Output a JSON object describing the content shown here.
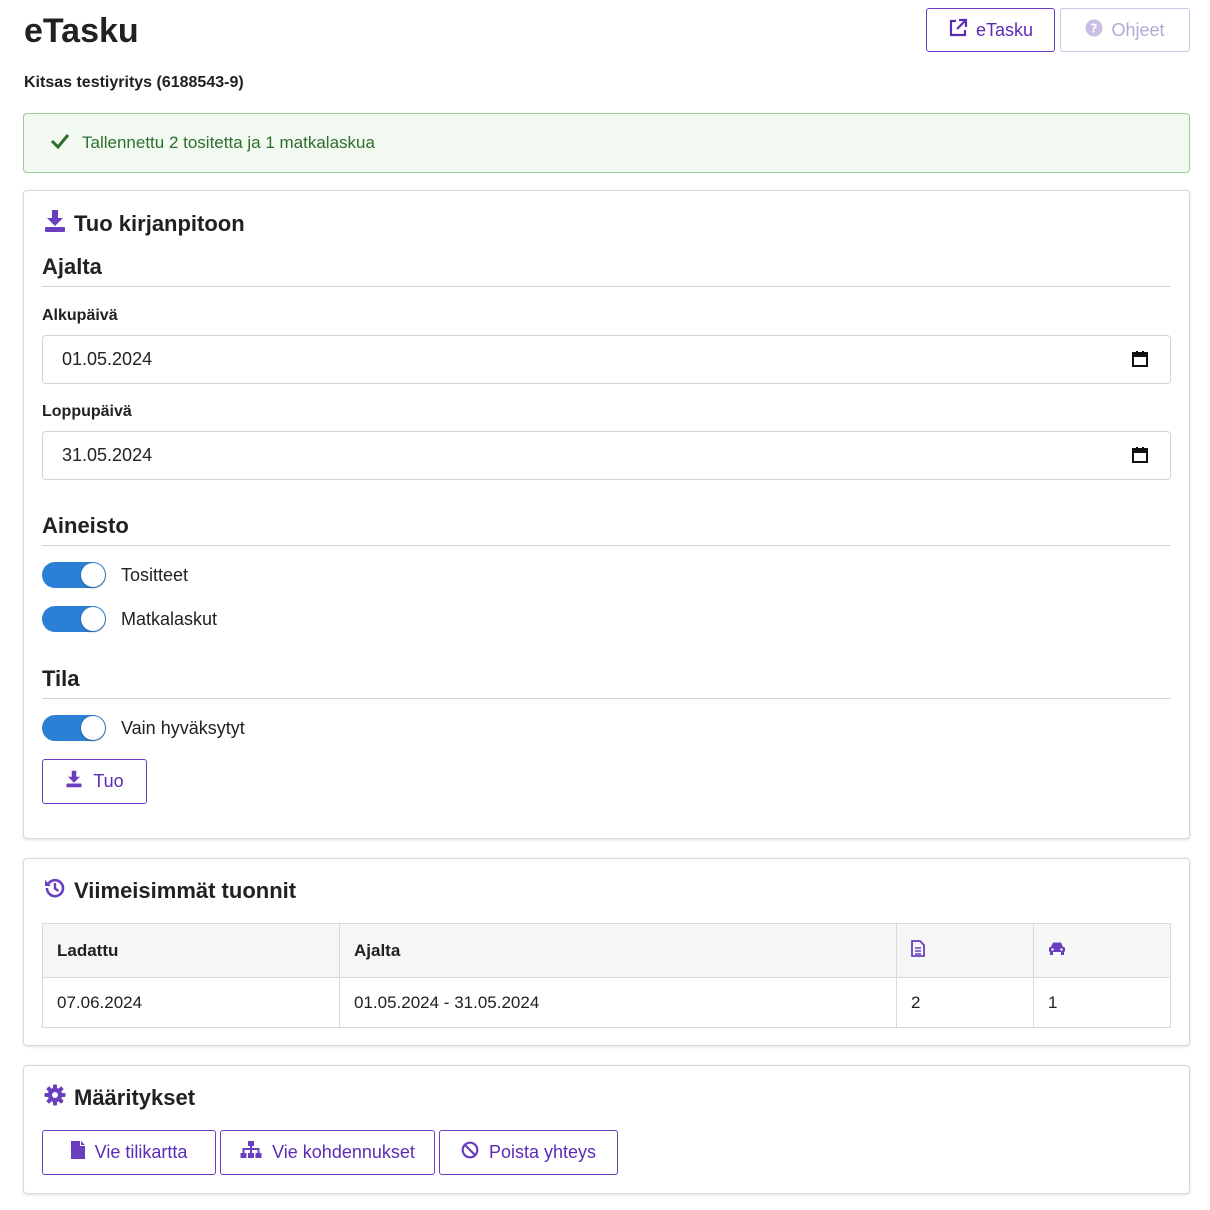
{
  "header": {
    "title": "eTasku",
    "company": "Kitsas testiyritys (6188543-9)",
    "etasku_button": "eTasku",
    "help_button": "Ohjeet"
  },
  "alert": {
    "message": "Tallennettu 2 tositetta ja 1 matkalaskua"
  },
  "import_card": {
    "title": "Tuo kirjanpitoon",
    "period_heading": "Ajalta",
    "start_label": "Alkupäivä",
    "start_value": "01.05.2024",
    "end_label": "Loppupäivä",
    "end_value": "31.05.2024",
    "material_heading": "Aineisto",
    "toggle_receipts": "Tositteet",
    "toggle_travel": "Matkalaskut",
    "state_heading": "Tila",
    "toggle_approved": "Vain hyväksytyt",
    "import_button": "Tuo",
    "toggles_on": [
      true,
      true,
      true
    ]
  },
  "recent_card": {
    "title": "Viimeisimmät tuonnit",
    "columns": [
      "Ladattu",
      "Ajalta",
      "document-icon",
      "car-icon"
    ],
    "rows": [
      {
        "loaded": "07.06.2024",
        "period": "01.05.2024 - 31.05.2024",
        "documents": "2",
        "travel": "1"
      }
    ]
  },
  "settings_card": {
    "title": "Määritykset",
    "export_accounts": "Vie tilikartta",
    "export_allocations": "Vie kohdennukset",
    "remove_connection": "Poista yhteys"
  },
  "colors": {
    "accent": "#5b2bb5",
    "toggle": "#2b7fd4",
    "success_bg": "#f2f9f1",
    "success_text": "#2e6e2e"
  }
}
